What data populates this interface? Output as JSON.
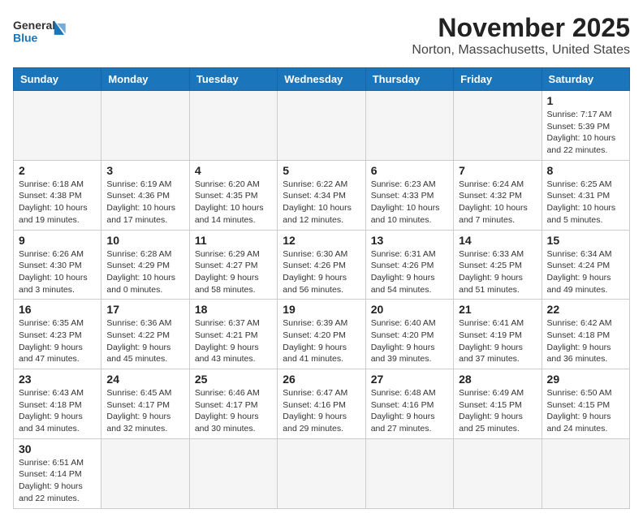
{
  "logo": {
    "text_general": "General",
    "text_blue": "Blue"
  },
  "header": {
    "month": "November 2025",
    "location": "Norton, Massachusetts, United States"
  },
  "weekdays": [
    "Sunday",
    "Monday",
    "Tuesday",
    "Wednesday",
    "Thursday",
    "Friday",
    "Saturday"
  ],
  "weeks": [
    [
      {
        "day": "",
        "empty": true
      },
      {
        "day": "",
        "empty": true
      },
      {
        "day": "",
        "empty": true
      },
      {
        "day": "",
        "empty": true
      },
      {
        "day": "",
        "empty": true
      },
      {
        "day": "",
        "empty": true
      },
      {
        "day": "1",
        "info": "Sunrise: 7:17 AM\nSunset: 5:39 PM\nDaylight: 10 hours\nand 22 minutes."
      }
    ],
    [
      {
        "day": "2",
        "info": "Sunrise: 6:18 AM\nSunset: 4:38 PM\nDaylight: 10 hours\nand 19 minutes."
      },
      {
        "day": "3",
        "info": "Sunrise: 6:19 AM\nSunset: 4:36 PM\nDaylight: 10 hours\nand 17 minutes."
      },
      {
        "day": "4",
        "info": "Sunrise: 6:20 AM\nSunset: 4:35 PM\nDaylight: 10 hours\nand 14 minutes."
      },
      {
        "day": "5",
        "info": "Sunrise: 6:22 AM\nSunset: 4:34 PM\nDaylight: 10 hours\nand 12 minutes."
      },
      {
        "day": "6",
        "info": "Sunrise: 6:23 AM\nSunset: 4:33 PM\nDaylight: 10 hours\nand 10 minutes."
      },
      {
        "day": "7",
        "info": "Sunrise: 6:24 AM\nSunset: 4:32 PM\nDaylight: 10 hours\nand 7 minutes."
      },
      {
        "day": "8",
        "info": "Sunrise: 6:25 AM\nSunset: 4:31 PM\nDaylight: 10 hours\nand 5 minutes."
      }
    ],
    [
      {
        "day": "9",
        "info": "Sunrise: 6:26 AM\nSunset: 4:30 PM\nDaylight: 10 hours\nand 3 minutes."
      },
      {
        "day": "10",
        "info": "Sunrise: 6:28 AM\nSunset: 4:29 PM\nDaylight: 10 hours\nand 0 minutes."
      },
      {
        "day": "11",
        "info": "Sunrise: 6:29 AM\nSunset: 4:27 PM\nDaylight: 9 hours\nand 58 minutes."
      },
      {
        "day": "12",
        "info": "Sunrise: 6:30 AM\nSunset: 4:26 PM\nDaylight: 9 hours\nand 56 minutes."
      },
      {
        "day": "13",
        "info": "Sunrise: 6:31 AM\nSunset: 4:26 PM\nDaylight: 9 hours\nand 54 minutes."
      },
      {
        "day": "14",
        "info": "Sunrise: 6:33 AM\nSunset: 4:25 PM\nDaylight: 9 hours\nand 51 minutes."
      },
      {
        "day": "15",
        "info": "Sunrise: 6:34 AM\nSunset: 4:24 PM\nDaylight: 9 hours\nand 49 minutes."
      }
    ],
    [
      {
        "day": "16",
        "info": "Sunrise: 6:35 AM\nSunset: 4:23 PM\nDaylight: 9 hours\nand 47 minutes."
      },
      {
        "day": "17",
        "info": "Sunrise: 6:36 AM\nSunset: 4:22 PM\nDaylight: 9 hours\nand 45 minutes."
      },
      {
        "day": "18",
        "info": "Sunrise: 6:37 AM\nSunset: 4:21 PM\nDaylight: 9 hours\nand 43 minutes."
      },
      {
        "day": "19",
        "info": "Sunrise: 6:39 AM\nSunset: 4:20 PM\nDaylight: 9 hours\nand 41 minutes."
      },
      {
        "day": "20",
        "info": "Sunrise: 6:40 AM\nSunset: 4:20 PM\nDaylight: 9 hours\nand 39 minutes."
      },
      {
        "day": "21",
        "info": "Sunrise: 6:41 AM\nSunset: 4:19 PM\nDaylight: 9 hours\nand 37 minutes."
      },
      {
        "day": "22",
        "info": "Sunrise: 6:42 AM\nSunset: 4:18 PM\nDaylight: 9 hours\nand 36 minutes."
      }
    ],
    [
      {
        "day": "23",
        "info": "Sunrise: 6:43 AM\nSunset: 4:18 PM\nDaylight: 9 hours\nand 34 minutes."
      },
      {
        "day": "24",
        "info": "Sunrise: 6:45 AM\nSunset: 4:17 PM\nDaylight: 9 hours\nand 32 minutes."
      },
      {
        "day": "25",
        "info": "Sunrise: 6:46 AM\nSunset: 4:17 PM\nDaylight: 9 hours\nand 30 minutes."
      },
      {
        "day": "26",
        "info": "Sunrise: 6:47 AM\nSunset: 4:16 PM\nDaylight: 9 hours\nand 29 minutes."
      },
      {
        "day": "27",
        "info": "Sunrise: 6:48 AM\nSunset: 4:16 PM\nDaylight: 9 hours\nand 27 minutes."
      },
      {
        "day": "28",
        "info": "Sunrise: 6:49 AM\nSunset: 4:15 PM\nDaylight: 9 hours\nand 25 minutes."
      },
      {
        "day": "29",
        "info": "Sunrise: 6:50 AM\nSunset: 4:15 PM\nDaylight: 9 hours\nand 24 minutes."
      }
    ],
    [
      {
        "day": "30",
        "info": "Sunrise: 6:51 AM\nSunset: 4:14 PM\nDaylight: 9 hours\nand 22 minutes."
      },
      {
        "day": "",
        "empty": true
      },
      {
        "day": "",
        "empty": true
      },
      {
        "day": "",
        "empty": true
      },
      {
        "day": "",
        "empty": true
      },
      {
        "day": "",
        "empty": true
      },
      {
        "day": "",
        "empty": true
      }
    ]
  ]
}
